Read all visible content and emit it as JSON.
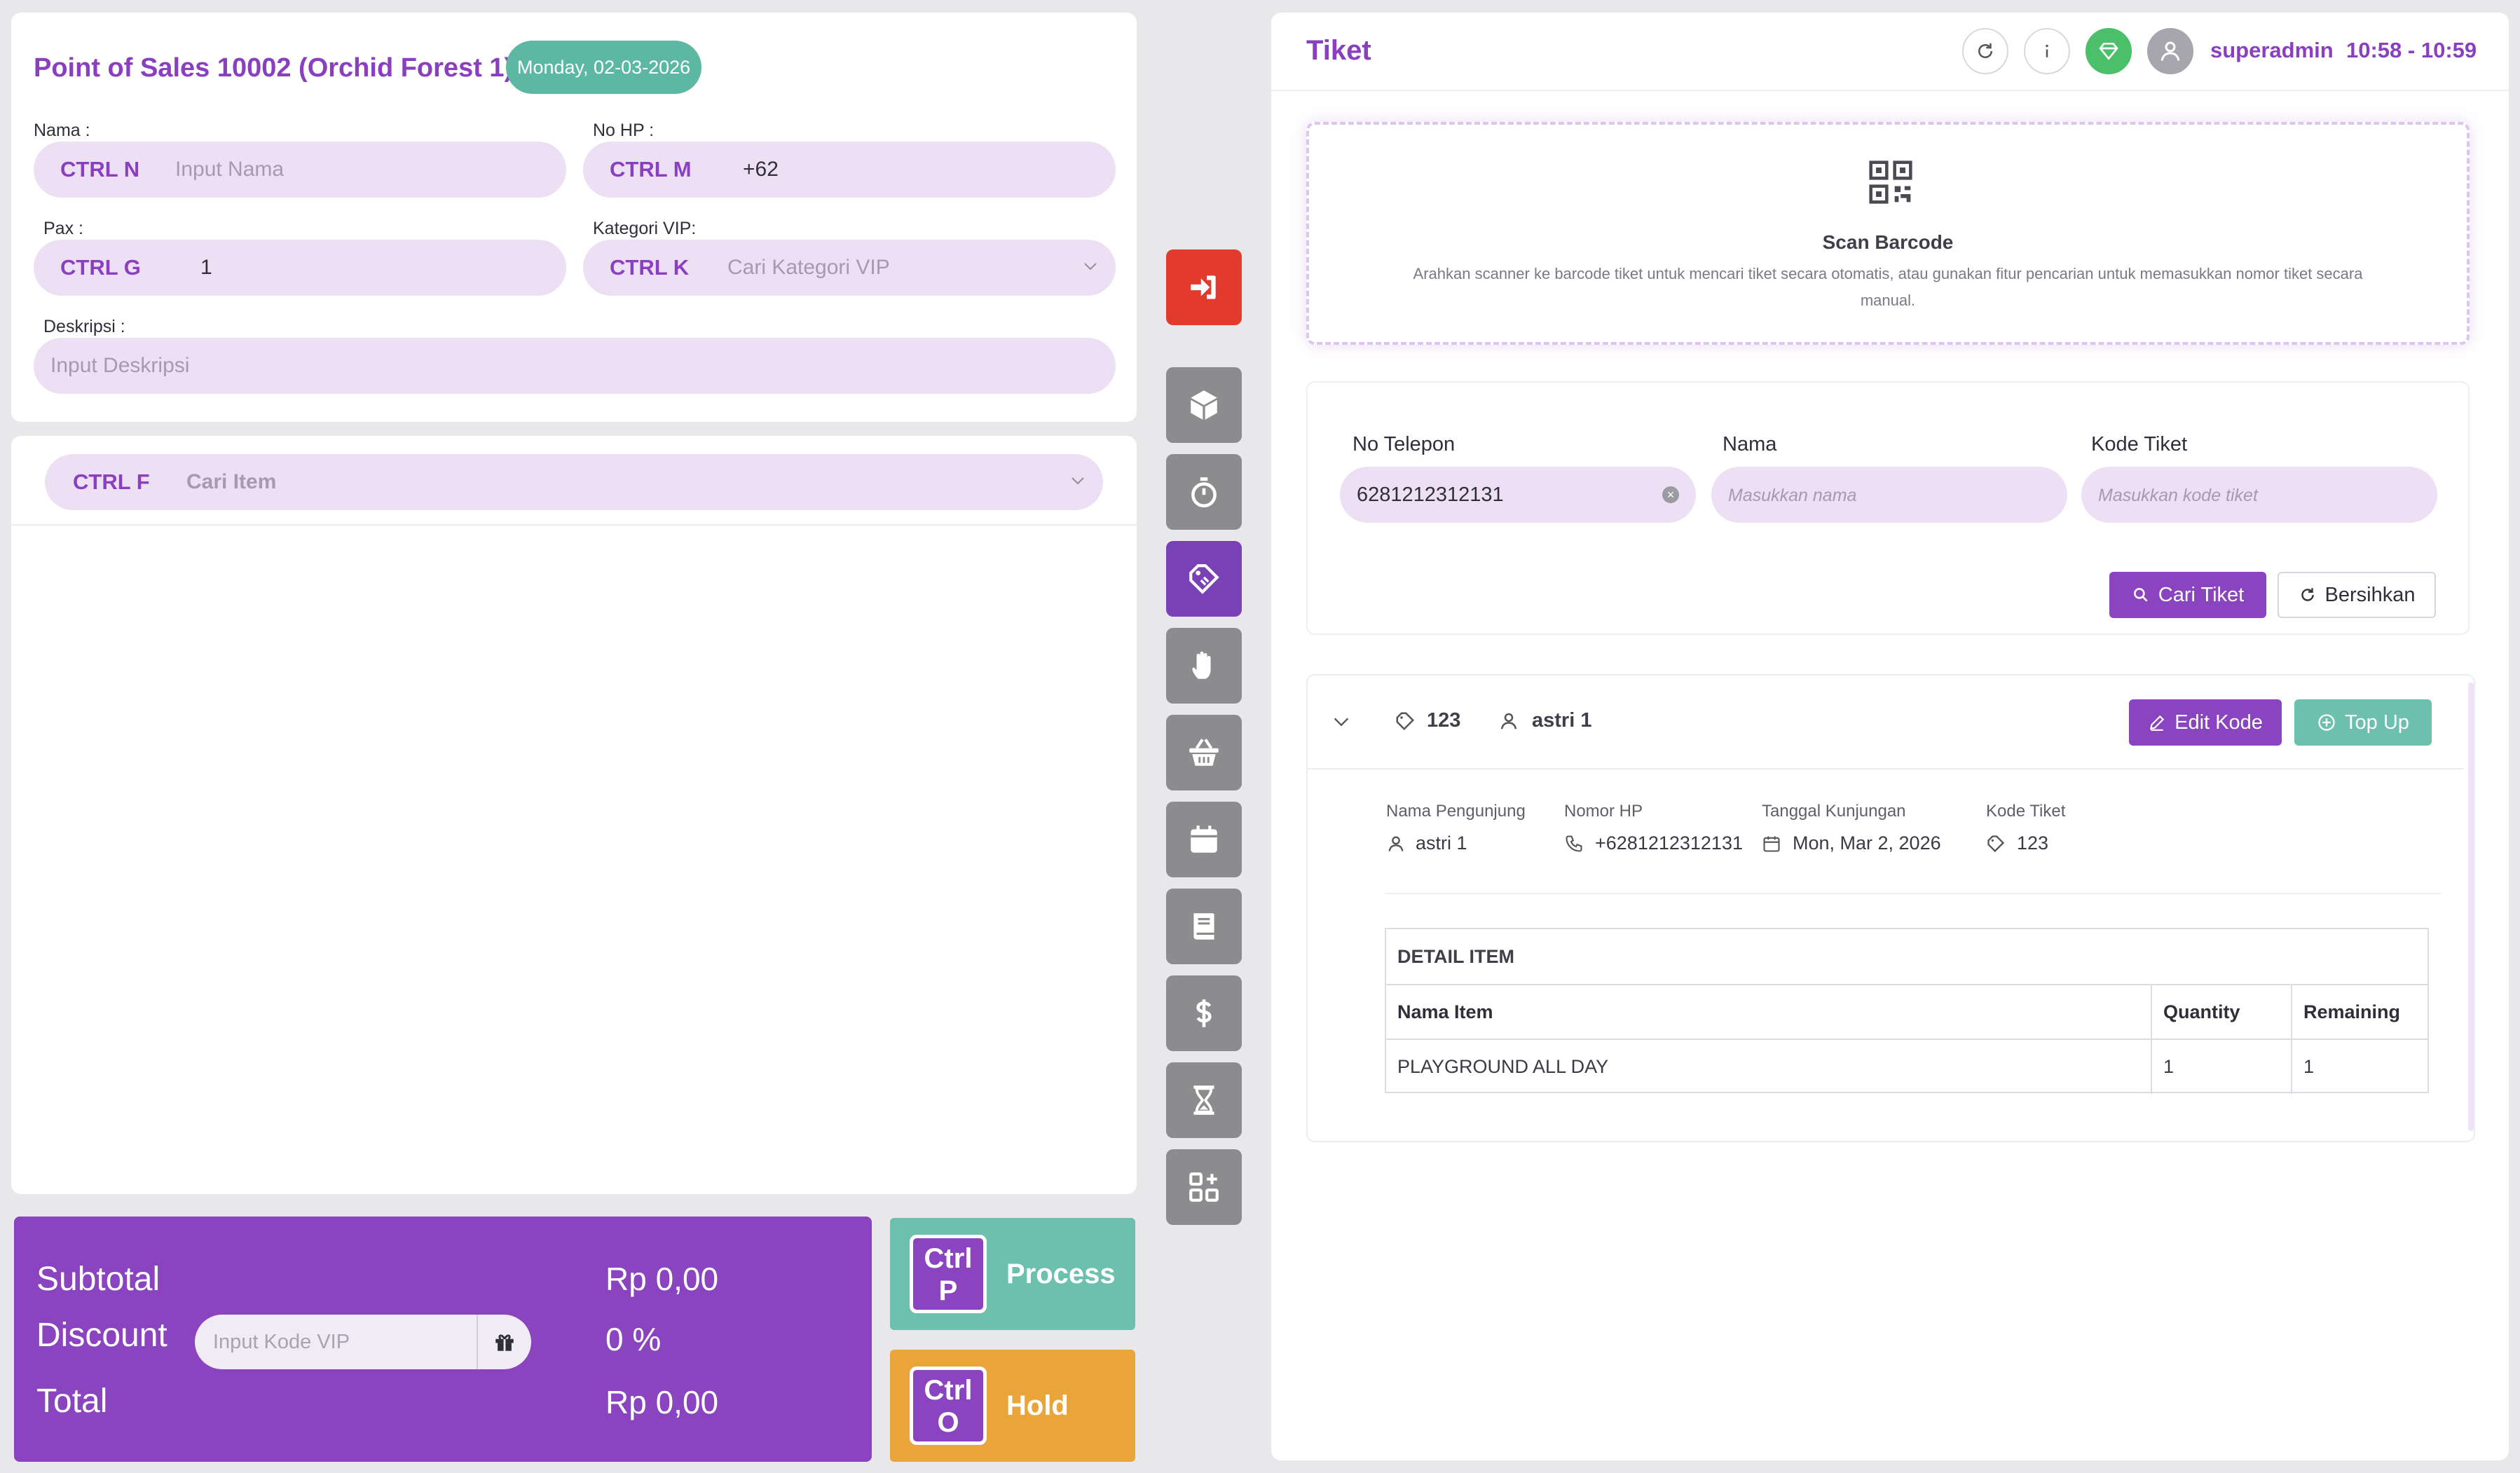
{
  "colors": {
    "brand_purple": "#8a44bf",
    "accent_teal": "#6cc0ad",
    "hold_orange": "#e9a43a",
    "exit_red": "#e23b2e",
    "status_green": "#4cbf6a"
  },
  "form": {
    "title": "Point of Sales 10002 (Orchid Forest 1)",
    "date": "Monday, 02-03-2026",
    "nama_label": "Nama :",
    "nama_key": "CTRL N",
    "nama_placeholder": "Input Nama",
    "nohp_label": "No HP :",
    "nohp_key": "CTRL M",
    "nohp_value": "+62",
    "pax_label": "Pax :",
    "pax_key": "CTRL G",
    "pax_value": "1",
    "vip_label": "Kategori VIP:",
    "vip_key": "CTRL K",
    "vip_placeholder": "Cari Kategori VIP",
    "desc_label": "Deskripsi :",
    "desc_placeholder": "Input Deskripsi"
  },
  "item_search": {
    "key": "CTRL F",
    "placeholder": "Cari Item"
  },
  "summary": {
    "subtotal_label": "Subtotal",
    "subtotal_value": "Rp 0,00",
    "discount_label": "Discount",
    "vip_code_placeholder": "Input Kode VIP",
    "discount_value": "0 %",
    "total_label": "Total",
    "total_value": "Rp 0,00"
  },
  "actions": {
    "process_key_line1": "Ctrl",
    "process_key_line2": "P",
    "process_label": "Process",
    "hold_key_line1": "Ctrl",
    "hold_key_line2": "O",
    "hold_label": "Hold"
  },
  "toolbar": {
    "items": [
      "exit-icon",
      "box-icon",
      "stopwatch-icon",
      "ticket-icon",
      "hand-icon",
      "basket-icon",
      "calendar-icon",
      "book-icon",
      "dollar-icon",
      "hourglass-icon",
      "apps-icon"
    ],
    "active": "ticket-icon"
  },
  "header": {
    "title": "Tiket",
    "user": "superadmin",
    "time": "10:58 - 10:59"
  },
  "scan": {
    "title": "Scan Barcode",
    "description": "Arahkan scanner ke barcode tiket untuk mencari tiket secara otomatis, atau gunakan fitur pencarian untuk memasukkan nomor tiket secara manual."
  },
  "search": {
    "phone_label": "No Telepon",
    "phone_value": "6281212312131",
    "name_label": "Nama",
    "name_placeholder": "Masukkan nama",
    "code_label": "Kode Tiket",
    "code_placeholder": "Masukkan kode tiket",
    "search_button": "Cari Tiket",
    "clear_button": "Bersihkan"
  },
  "result": {
    "ticket_code": "123",
    "visitor": "astri 1",
    "edit_button": "Edit Kode",
    "topup_button": "Top Up",
    "visitor_label": "Nama Pengunjung",
    "visitor_value": "astri 1",
    "phone_label": "Nomor HP",
    "phone_value": "+6281212312131",
    "date_label": "Tanggal Kunjungan",
    "date_value": "Mon, Mar 2, 2026",
    "code_label": "Kode Tiket",
    "code_value": "123",
    "detail_title": "DETAIL ITEM",
    "columns": [
      "Nama Item",
      "Quantity",
      "Remaining"
    ],
    "rows": [
      [
        "PLAYGROUND ALL DAY",
        "1",
        "1"
      ]
    ]
  }
}
